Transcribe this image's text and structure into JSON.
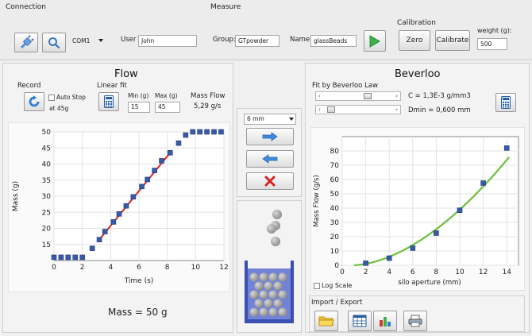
{
  "connection": {
    "title": "Connection",
    "port": "COM1",
    "user_label": "User",
    "user_value": "John"
  },
  "measure": {
    "title": "Measure",
    "group_label": "Group:",
    "group_value": "GTpowder",
    "name_label": "Name:",
    "name_value": "glassBeads"
  },
  "calibration": {
    "title": "Calibration",
    "zero_label": "Zero",
    "calibrate_label": "Calibrate",
    "weight_label": "weight (g):",
    "weight_value": "500"
  },
  "flow": {
    "title": "Flow",
    "record_label": "Record",
    "auto_stop_label": "Auto Stop",
    "auto_stop_at": "at 45g",
    "linear_fit_label": "Linear fit",
    "min_label": "Min (g)",
    "max_label": "Max (g)",
    "min_value": "15",
    "max_value": "45",
    "mass_flow_label": "Mass Flow",
    "mass_flow_value": "5,29 g/s",
    "mass_readout": "Mass = 50 g"
  },
  "middle": {
    "aperture_select": "6 mm"
  },
  "beverloo": {
    "title": "Beverloo",
    "fit_label": "Fit by Beverloo Law",
    "c_text": "C = 1,3E-3 g/mm3",
    "dmin_text": "Dmin = 0,600 mm",
    "log_scale_label": "Log Scale",
    "import_export_label": "Import / Export"
  },
  "colors": {
    "points": "#3a5aa8",
    "fit_flow": "#e02020",
    "fit_beverloo": "#6cbf3a",
    "accent_green": "#3bb34a",
    "accent_blue": "#2f7fd4"
  },
  "chart_data": [
    {
      "type": "scatter",
      "xlabel": "Time (s)",
      "ylabel": "Mass (g)",
      "xlim": [
        0,
        12
      ],
      "ylim": [
        10,
        50
      ],
      "xticks": [
        0,
        2,
        4,
        6,
        8,
        10,
        12
      ],
      "yticks": [
        15,
        20,
        25,
        30,
        35,
        40,
        45,
        50
      ],
      "grid": true,
      "points": [
        [
          0.0,
          11
        ],
        [
          0.5,
          11
        ],
        [
          1.0,
          11
        ],
        [
          1.5,
          11
        ],
        [
          2.0,
          11
        ],
        [
          2.7,
          13.8
        ],
        [
          3.2,
          16.5
        ],
        [
          3.6,
          19
        ],
        [
          4.2,
          22
        ],
        [
          4.6,
          24.5
        ],
        [
          5.1,
          27
        ],
        [
          5.6,
          29.8
        ],
        [
          6.2,
          33
        ],
        [
          6.6,
          35.2
        ],
        [
          7.1,
          38
        ],
        [
          7.6,
          41
        ],
        [
          8.2,
          43.5
        ],
        [
          8.8,
          46.5
        ],
        [
          9.3,
          49
        ],
        [
          9.8,
          50
        ],
        [
          10.3,
          50
        ],
        [
          10.8,
          50
        ],
        [
          11.3,
          50
        ],
        [
          11.8,
          50
        ]
      ],
      "fit_line": {
        "x": [
          3.2,
          8.2
        ],
        "y": [
          16.5,
          43.5
        ]
      }
    },
    {
      "type": "scatter",
      "xlabel": "silo aperture (mm)",
      "ylabel": "Mass Flow (g/s)",
      "xlim": [
        0,
        15
      ],
      "ylim": [
        0,
        90
      ],
      "xticks": [
        0,
        2,
        4,
        6,
        8,
        10,
        12,
        14
      ],
      "yticks": [
        0,
        10,
        20,
        30,
        40,
        50,
        60,
        70,
        80
      ],
      "grid": true,
      "points": [
        [
          2,
          1.5
        ],
        [
          4,
          5
        ],
        [
          6,
          12
        ],
        [
          8,
          22.5
        ],
        [
          10,
          38.5
        ],
        [
          12,
          57.5
        ],
        [
          14,
          82
        ]
      ],
      "fit_curve": {
        "c": 0.0013,
        "dmin": 0.6,
        "k": 1.4,
        "x_from": 1,
        "x_to": 14.2
      }
    }
  ]
}
